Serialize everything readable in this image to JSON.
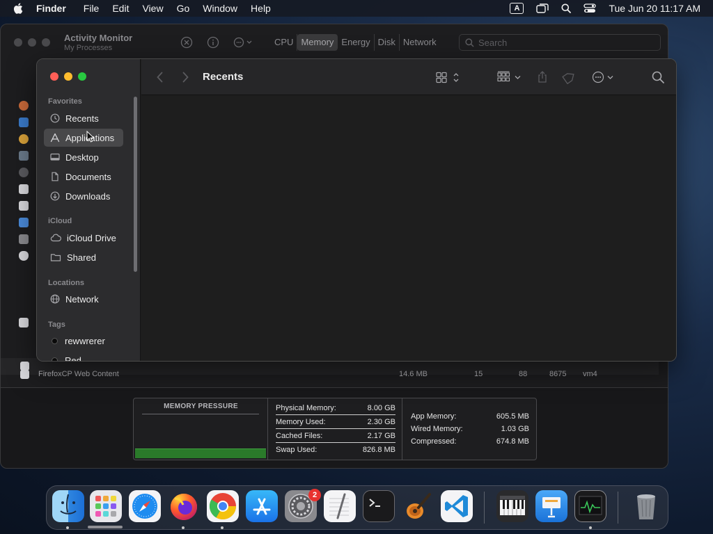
{
  "menubar": {
    "app_name": "Finder",
    "menus": [
      "File",
      "Edit",
      "View",
      "Go",
      "Window",
      "Help"
    ],
    "input_source": "A",
    "clock": "Tue Jun 20  11:17 AM",
    "icons": [
      "apple-icon",
      "input-source-icon",
      "screen-mirroring-icon",
      "spotlight-search-icon",
      "control-center-icon"
    ]
  },
  "activity_monitor": {
    "title": "Activity Monitor",
    "subtitle": "My Processes",
    "tabs": [
      "CPU",
      "Memory",
      "Energy",
      "Disk",
      "Network"
    ],
    "active_tab": "Memory",
    "search_placeholder": "Search",
    "row": {
      "name": "FirefoxCP Web Content",
      "memory": "14.6 MB",
      "threads": "15",
      "ports": "88",
      "pid": "8675",
      "user": "vm4"
    },
    "memory_panel": {
      "pressure_title": "MEMORY PRESSURE",
      "left_stats": [
        {
          "label": "Physical Memory:",
          "value": "8.00 GB"
        },
        {
          "label": "Memory Used:",
          "value": "2.30 GB"
        },
        {
          "label": "Cached Files:",
          "value": "2.17 GB"
        },
        {
          "label": "Swap Used:",
          "value": "826.8 MB"
        }
      ],
      "right_stats": [
        {
          "label": "App Memory:",
          "value": "605.5 MB"
        },
        {
          "label": "Wired Memory:",
          "value": "1.03 GB"
        },
        {
          "label": "Compressed:",
          "value": "674.8 MB"
        }
      ],
      "pressure_color": "#2a7a2a"
    }
  },
  "finder": {
    "title": "Recents",
    "sections": {
      "favorites": "Favorites",
      "icloud": "iCloud",
      "locations": "Locations",
      "tags": "Tags"
    },
    "favorites": [
      {
        "label": "Recents",
        "icon": "clock-icon"
      },
      {
        "label": "Applications",
        "icon": "applications-icon"
      },
      {
        "label": "Desktop",
        "icon": "desktop-icon"
      },
      {
        "label": "Documents",
        "icon": "document-icon"
      },
      {
        "label": "Downloads",
        "icon": "download-icon"
      }
    ],
    "icloud": [
      {
        "label": "iCloud Drive",
        "icon": "cloud-icon"
      },
      {
        "label": "Shared",
        "icon": "shared-folder-icon"
      }
    ],
    "locations": [
      {
        "label": "Network",
        "icon": "globe-icon"
      }
    ],
    "tags": [
      {
        "label": "rewwrerer",
        "color": "#0a0a0a"
      },
      {
        "label": "Red",
        "color": "#0a0a0a"
      }
    ],
    "selected_item": "Applications",
    "traffic_lights": {
      "close": "#ff5f57",
      "minimize": "#febc2e",
      "zoom": "#28c840"
    }
  },
  "dock": {
    "apps": [
      {
        "name": "Finder",
        "icon": "finder-icon",
        "running": true
      },
      {
        "name": "Launchpad",
        "icon": "launchpad-icon",
        "running": false
      },
      {
        "name": "Safari",
        "icon": "safari-icon",
        "running": false
      },
      {
        "name": "Firefox",
        "icon": "firefox-icon",
        "running": true
      },
      {
        "name": "Chrome",
        "icon": "chrome-icon",
        "running": true
      },
      {
        "name": "App Store",
        "icon": "app-store-icon",
        "running": false
      },
      {
        "name": "System Settings",
        "icon": "system-settings-icon",
        "running": false,
        "badge": "2"
      },
      {
        "name": "TextEdit",
        "icon": "textedit-icon",
        "running": false
      },
      {
        "name": "Terminal",
        "icon": "terminal-icon",
        "running": false
      },
      {
        "name": "GarageBand",
        "icon": "garageband-icon",
        "running": false
      },
      {
        "name": "Visual Studio Code",
        "icon": "vscode-icon",
        "running": false
      },
      {
        "name": "MIDI Keyboard",
        "icon": "piano-keyboard-icon",
        "running": false
      },
      {
        "name": "Keynote",
        "icon": "keynote-icon",
        "running": false
      },
      {
        "name": "Activity Monitor",
        "icon": "activity-monitor-icon",
        "running": true
      },
      {
        "name": "Trash",
        "icon": "trash-icon",
        "running": false
      }
    ]
  }
}
